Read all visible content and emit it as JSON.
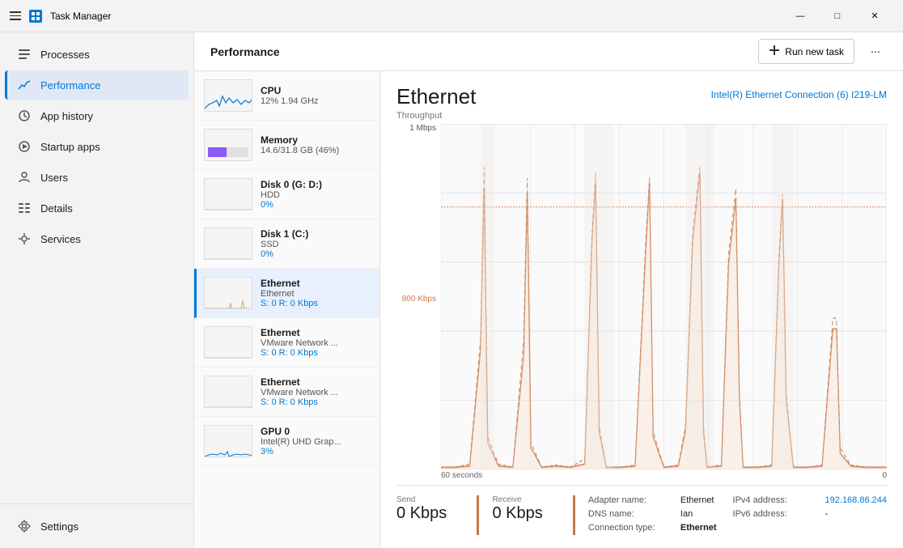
{
  "titlebar": {
    "title": "Task Manager",
    "min_label": "—",
    "max_label": "□",
    "close_label": "✕"
  },
  "sidebar": {
    "items": [
      {
        "id": "processes",
        "label": "Processes",
        "icon": "processes-icon"
      },
      {
        "id": "performance",
        "label": "Performance",
        "icon": "performance-icon",
        "active": true
      },
      {
        "id": "app-history",
        "label": "App history",
        "icon": "apphistory-icon"
      },
      {
        "id": "startup-apps",
        "label": "Startup apps",
        "icon": "startup-icon"
      },
      {
        "id": "users",
        "label": "Users",
        "icon": "users-icon"
      },
      {
        "id": "details",
        "label": "Details",
        "icon": "details-icon"
      },
      {
        "id": "services",
        "label": "Services",
        "icon": "services-icon"
      }
    ],
    "bottom": {
      "id": "settings",
      "label": "Settings",
      "icon": "settings-icon"
    }
  },
  "header": {
    "title": "Performance",
    "run_new_task": "Run new task",
    "more_icon": "⋯"
  },
  "perf_list": [
    {
      "id": "cpu",
      "name": "CPU",
      "sub": "12% 1.94 GHz",
      "type": "cpu"
    },
    {
      "id": "memory",
      "name": "Memory",
      "sub": "14.6/31.8 GB (46%)",
      "type": "memory"
    },
    {
      "id": "disk0",
      "name": "Disk 0 (G: D:)",
      "sub": "HDD",
      "val": "0%",
      "type": "disk"
    },
    {
      "id": "disk1",
      "name": "Disk 1 (C:)",
      "sub": "SSD",
      "val": "0%",
      "type": "disk"
    },
    {
      "id": "ethernet1",
      "name": "Ethernet",
      "sub": "Ethernet",
      "val": "S: 0 R: 0 Kbps",
      "type": "ethernet",
      "active": true
    },
    {
      "id": "ethernet2",
      "name": "Ethernet",
      "sub": "VMware Network ...",
      "val": "S: 0 R: 0 Kbps",
      "type": "ethernet"
    },
    {
      "id": "ethernet3",
      "name": "Ethernet",
      "sub": "VMware Network ...",
      "val": "S: 0 R: 0 Kbps",
      "type": "ethernet"
    },
    {
      "id": "gpu0",
      "name": "GPU 0",
      "sub": "Intel(R) UHD Grap...",
      "val": "3%",
      "type": "gpu"
    }
  ],
  "detail": {
    "title": "Ethernet",
    "subtitle": "Intel(R) Ethernet Connection (6) I219-LM",
    "y_max": "1 Mbps",
    "y_mid": "800 Kbps",
    "x_left": "60 seconds",
    "x_right": "0",
    "throughput_label": "Throughput",
    "send_label": "Send",
    "send_value": "0 Kbps",
    "receive_label": "Receive",
    "receive_value": "0 Kbps",
    "info": {
      "adapter_name_key": "Adapter name:",
      "adapter_name_val": "Ethernet",
      "dns_name_key": "DNS name:",
      "dns_name_val": "Ian",
      "connection_type_key": "Connection type:",
      "connection_type_val": "Ethernet",
      "ipv4_key": "IPv4 address:",
      "ipv4_val": "192.168.86.244",
      "ipv6_key": "IPv6 address:",
      "ipv6_val": "-"
    }
  }
}
